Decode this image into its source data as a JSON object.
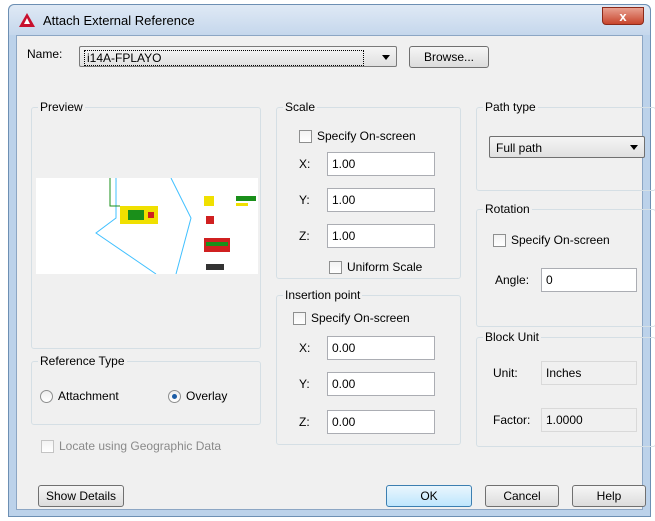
{
  "window": {
    "title": "Attach External Reference",
    "close_label": "x"
  },
  "name_row": {
    "label": "Name:",
    "value": "i14A-FPLAYO",
    "browse_label": "Browse..."
  },
  "preview": {
    "title": "Preview"
  },
  "scale": {
    "title": "Scale",
    "specify_label": "Specify On-screen",
    "x_label": "X:",
    "x_value": "1.00",
    "y_label": "Y:",
    "y_value": "1.00",
    "z_label": "Z:",
    "z_value": "1.00",
    "uniform_label": "Uniform Scale"
  },
  "path_type": {
    "title": "Path type",
    "value": "Full path"
  },
  "rotation": {
    "title": "Rotation",
    "specify_label": "Specify On-screen",
    "angle_label": "Angle:",
    "angle_value": "0"
  },
  "insertion": {
    "title": "Insertion point",
    "specify_label": "Specify On-screen",
    "x_label": "X:",
    "x_value": "0.00",
    "y_label": "Y:",
    "y_value": "0.00",
    "z_label": "Z:",
    "z_value": "0.00"
  },
  "reference_type": {
    "title": "Reference Type",
    "attachment_label": "Attachment",
    "overlay_label": "Overlay",
    "selected": "Overlay"
  },
  "block_unit": {
    "title": "Block Unit",
    "unit_label": "Unit:",
    "unit_value": "Inches",
    "factor_label": "Factor:",
    "factor_value": "1.0000"
  },
  "geo": {
    "label": "Locate using Geographic Data"
  },
  "buttons": {
    "show_details": "Show Details",
    "ok": "OK",
    "cancel": "Cancel",
    "help": "Help"
  }
}
